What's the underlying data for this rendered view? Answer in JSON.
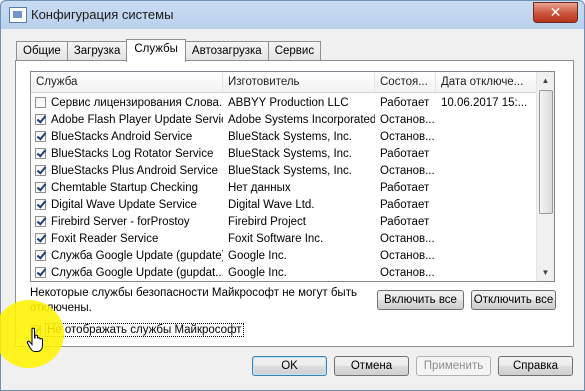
{
  "window": {
    "title": "Конфигурация системы",
    "close_glyph": "✕"
  },
  "tabs": [
    {
      "label": "Общие",
      "active": false
    },
    {
      "label": "Загрузка",
      "active": false
    },
    {
      "label": "Службы",
      "active": true
    },
    {
      "label": "Автозагрузка",
      "active": false
    },
    {
      "label": "Сервис",
      "active": false
    }
  ],
  "services_table": {
    "columns": [
      "Служба",
      "Изготовитель",
      "Состоя...",
      "Дата отключе..."
    ],
    "rows": [
      {
        "checked": false,
        "name": "Сервис лицензирования Слова...",
        "vendor": "ABBYY Production LLC",
        "status": "Работает",
        "date": "10.06.2017 15:..."
      },
      {
        "checked": true,
        "name": "Adobe Flash Player Update Service",
        "vendor": "Adobe Systems Incorporated",
        "status": "Останов...",
        "date": ""
      },
      {
        "checked": true,
        "name": "BlueStacks Android Service",
        "vendor": "BlueStack Systems, Inc.",
        "status": "Останов...",
        "date": ""
      },
      {
        "checked": true,
        "name": "BlueStacks Log Rotator Service",
        "vendor": "BlueStack Systems, Inc.",
        "status": "Работает",
        "date": ""
      },
      {
        "checked": true,
        "name": "BlueStacks Plus Android Service",
        "vendor": "BlueStack Systems, Inc.",
        "status": "Останов...",
        "date": ""
      },
      {
        "checked": true,
        "name": "Chemtable Startup Checking",
        "vendor": "Нет данных",
        "status": "Работает",
        "date": ""
      },
      {
        "checked": true,
        "name": "Digital Wave Update Service",
        "vendor": "Digital Wave Ltd.",
        "status": "Работает",
        "date": ""
      },
      {
        "checked": true,
        "name": "Firebird Server - forProstoy",
        "vendor": "Firebird Project",
        "status": "Работает",
        "date": ""
      },
      {
        "checked": true,
        "name": "Foxit Reader Service",
        "vendor": "Foxit Software Inc.",
        "status": "Останов...",
        "date": ""
      },
      {
        "checked": true,
        "name": "Служба Google Update (gupdate)",
        "vendor": "Google Inc.",
        "status": "Останов...",
        "date": ""
      },
      {
        "checked": true,
        "name": "Служба Google Update (gupdat...",
        "vendor": "Google Inc.",
        "status": "Останов...",
        "date": ""
      }
    ]
  },
  "notice": "Некоторые службы безопасности Майкрософт не могут быть отключены.",
  "buttons": {
    "enable_all": "Включить все",
    "disable_all": "Отключить все",
    "ok": "OK",
    "cancel": "Отмена",
    "apply": "Применить",
    "help": "Справка"
  },
  "hide_microsoft": {
    "label": "Не отображать службы Майкрософт",
    "checked": true
  },
  "colors": {
    "highlight": "#fff300",
    "title_bar": "#c9dcf2",
    "close_button": "#c9533b"
  }
}
